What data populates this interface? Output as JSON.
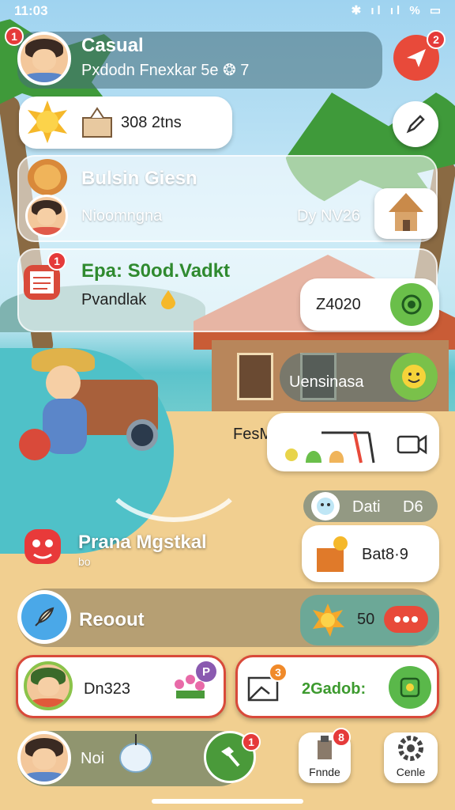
{
  "status_bar": {
    "time": "11:03",
    "icons": "✱ ıl ıl % ▭"
  },
  "profile": {
    "name": "Casual",
    "subtitle": "Pxdodn Fnexkar 5e ❂ 7",
    "badge": "1",
    "action_badge": "2"
  },
  "resources": {
    "value": "308 2tns"
  },
  "business": {
    "title": "Bulsin Giesn",
    "subtitle": "Nioomngna",
    "right_text": "Dy NV26"
  },
  "event": {
    "title": "Epa: S0od.Vadkt",
    "subtitle": "Pvandlak",
    "badge": "1"
  },
  "counter": {
    "value": "Z4020"
  },
  "quest": {
    "label": "Uensinasa"
  },
  "festival": {
    "label": "FesMad:"
  },
  "date_pill": {
    "label": "Dati",
    "value": "D6"
  },
  "crate": {
    "value": "Bat8·9"
  },
  "mask": {
    "title": "Prana Mgstkal",
    "subtitle": "bo"
  },
  "report": {
    "label": "Reoout",
    "counter": "50"
  },
  "friend_card": {
    "value": "Dn323",
    "badge": "P"
  },
  "mail_card": {
    "value": "2Gadob:",
    "badge": "3"
  },
  "bottom_nav": {
    "profile_label": "Noi",
    "map_badge": "1",
    "finance_label": "Fnnde",
    "finance_badge": "8",
    "settings_label": "Cenle"
  },
  "colors": {
    "accent_red": "#e53a3a",
    "accent_green": "#4a9a3a",
    "event_title_green": "#2f8a2f",
    "mail_value_green": "#3c9a2e"
  }
}
